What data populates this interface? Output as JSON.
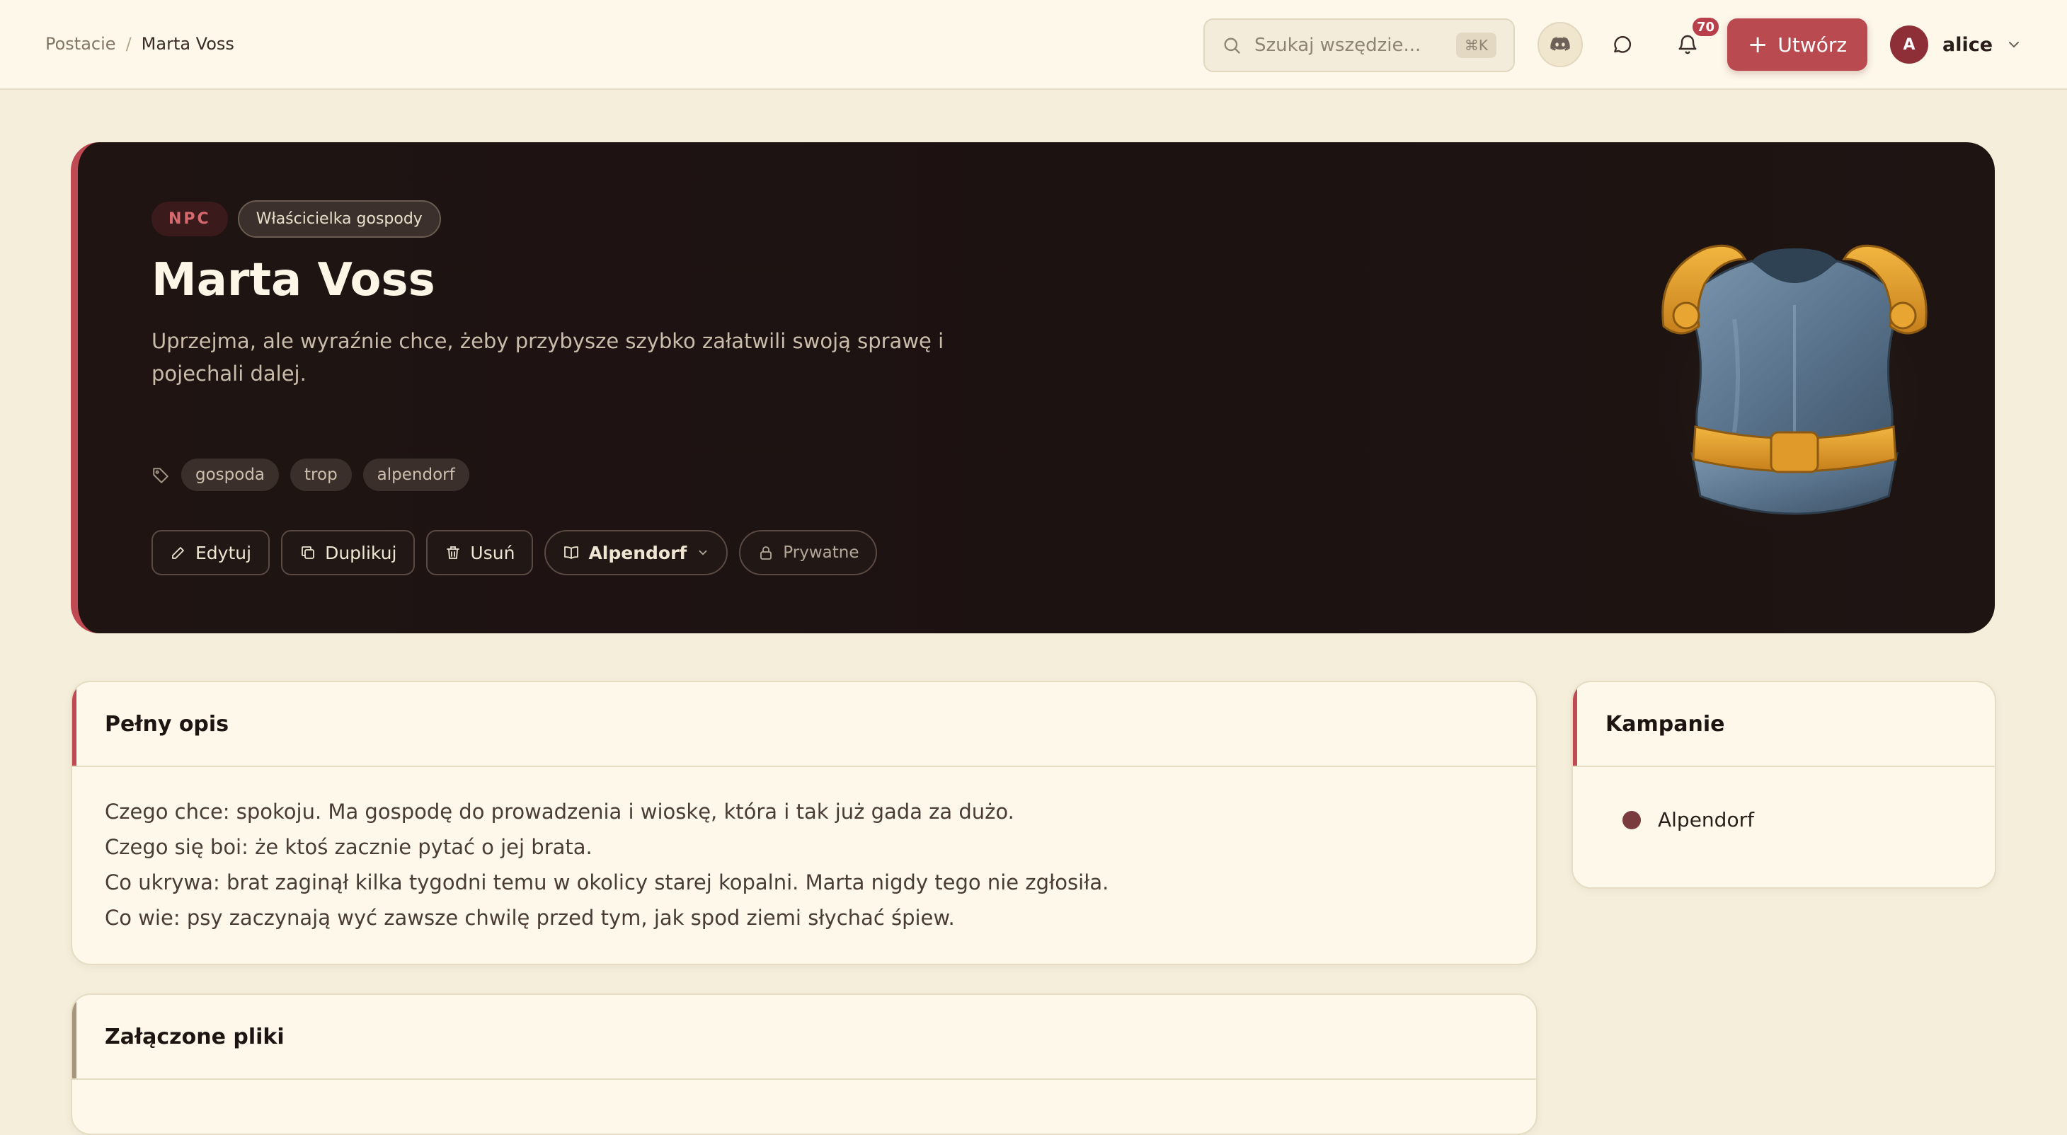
{
  "breadcrumb": {
    "parent": "Postacie",
    "separator": "/",
    "current": "Marta Voss"
  },
  "search": {
    "placeholder": "Szukaj wszędzie...",
    "shortcut": "⌘K"
  },
  "notifications": {
    "count": "70"
  },
  "header": {
    "create_label": "Utwórz",
    "create_icon": "plus-icon"
  },
  "user": {
    "initial": "A",
    "name": "alice"
  },
  "character": {
    "type_tag": "NPC",
    "role_tag": "Właścicielka gospody",
    "name": "Marta Voss",
    "summary": "Uprzejma, ale wyraźnie chce, żeby przybysze szybko załatwili swoją sprawę i pojechali dalej.",
    "keywords": [
      "gospoda",
      "trop",
      "alpendorf"
    ],
    "portrait_icon": "armor-breastplate-icon"
  },
  "actions": {
    "edit": "Edytuj",
    "duplicate": "Duplikuj",
    "delete": "Usuń",
    "campaign": "Alpendorf",
    "visibility": "Prywatne"
  },
  "description": {
    "title": "Pełny opis",
    "lines": [
      "Czego chce: spokoju. Ma gospodę do prowadzenia i wioskę, która i tak już gada za dużo.",
      "Czego się boi: że ktoś zacznie pytać o jej brata.",
      "Co ukrywa: brat zaginął kilka tygodni temu w okolicy starej kopalni. Marta nigdy tego nie zgłosiła.",
      "Co wie: psy zaczynają wyć zawsze chwilę przed tym, jak spod ziemi słychać śpiew."
    ]
  },
  "campaigns": {
    "title": "Kampanie",
    "items": [
      "Alpendorf"
    ],
    "dot_color": "#7a3b3e"
  },
  "files": {
    "title": "Załączone pliki"
  },
  "colors": {
    "accent": "#b94a50",
    "hero_bg": "#1f1412",
    "page_bg": "#f4eedb"
  }
}
